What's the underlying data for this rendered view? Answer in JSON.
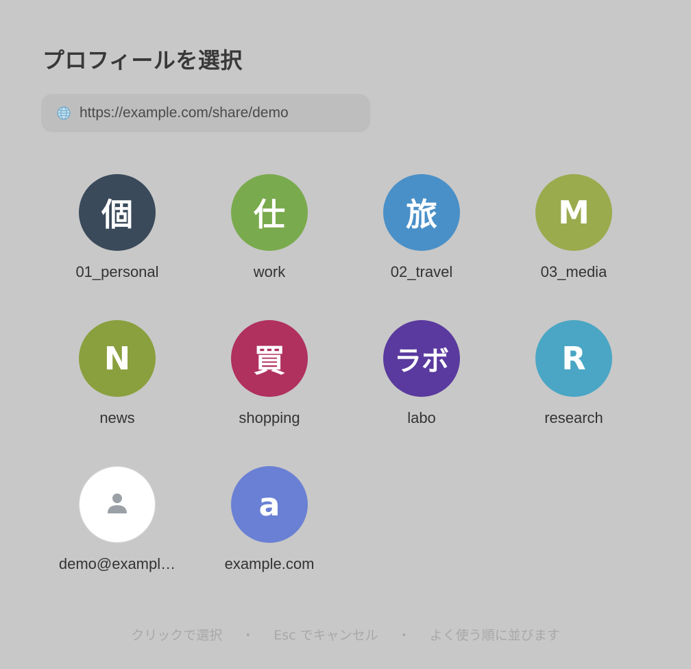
{
  "title": "プロフィールを選択",
  "url_bar": {
    "icon": "globe-icon",
    "text": "https://example.com/share/demo"
  },
  "profiles": [
    {
      "initial": "個",
      "label": "01_personal",
      "color": "#3a4a5a"
    },
    {
      "initial": "仕",
      "label": "work",
      "color": "#7aaa4e"
    },
    {
      "initial": "旅",
      "label": "02_travel",
      "color": "#4a90c8"
    },
    {
      "initial": "M",
      "label": "03_media",
      "color": "#9aab4e"
    },
    {
      "initial": "N",
      "label": "news",
      "color": "#8aa03e"
    },
    {
      "initial": "買",
      "label": "shopping",
      "color": "#b0305e"
    },
    {
      "initial": "ラボ",
      "label": "labo",
      "color": "#5a3a9e"
    },
    {
      "initial": "R",
      "label": "research",
      "color": "#4aa6c4"
    },
    {
      "initial": "",
      "label": "demo@exampl…",
      "color": "#ffffff",
      "icon": "person-icon"
    },
    {
      "initial": "a",
      "label": "example.com",
      "color": "#6a80d4"
    }
  ],
  "footer": {
    "hint1": "クリックで選択",
    "separator": "・",
    "hint2": "Esc でキャンセル",
    "hint3": "よく使う順に並びます"
  }
}
